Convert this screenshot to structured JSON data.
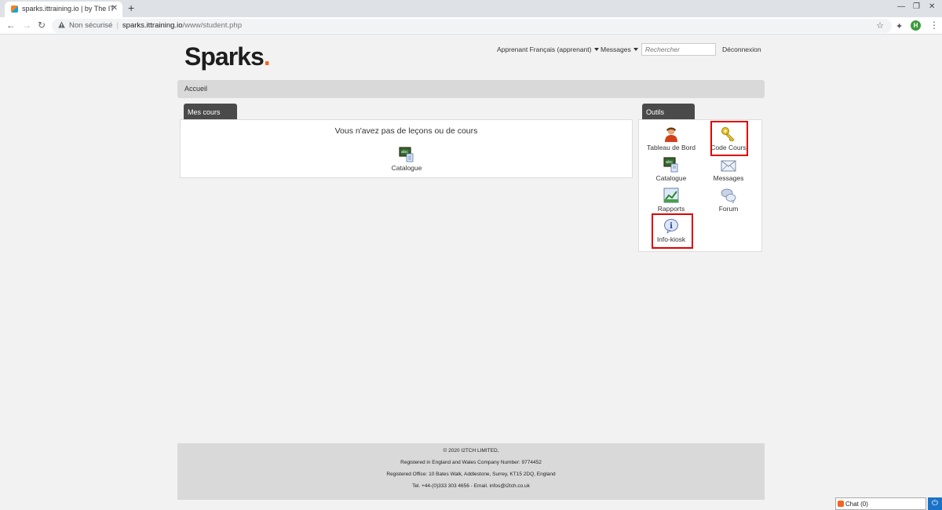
{
  "browser": {
    "tab_title": "sparks.ittraining.io | by The IT",
    "tab_close": "✕",
    "new_tab": "+",
    "address_insecure": "Non sécurisé",
    "address_domain": "sparks.ittraining.io",
    "address_path": "/www/student.php",
    "profile_initial": "H"
  },
  "header": {
    "logo_text": "Sparks",
    "logo_dot": ".",
    "user_menu": "Apprenant Français (apprenant)",
    "messages_menu": "Messages",
    "search_placeholder": "Rechercher",
    "logout": "Déconnexion"
  },
  "breadcrumb": {
    "label": "Accueil"
  },
  "courses": {
    "tab_label": "Mes cours",
    "empty_message": "Vous n'avez pas de leçons ou de cours",
    "catalogue_label": "Catalogue"
  },
  "tools": {
    "tab_label": "Outils",
    "items": [
      {
        "label": "Tableau de Bord",
        "icon": "user-icon",
        "highlighted": false
      },
      {
        "label": "Code Cours",
        "icon": "key-icon",
        "highlighted": true
      },
      {
        "label": "Catalogue",
        "icon": "catalogue-icon",
        "highlighted": false
      },
      {
        "label": "Messages",
        "icon": "envelope-icon",
        "highlighted": false
      },
      {
        "label": "Rapports",
        "icon": "report-chart-icon",
        "highlighted": false
      },
      {
        "label": "Forum",
        "icon": "forum-bubbles-icon",
        "highlighted": false
      },
      {
        "label": "Info-kiosk",
        "icon": "info-icon",
        "highlighted": true
      }
    ],
    "highlight_color": "#e00000"
  },
  "footer": {
    "line1": "© 2020 I2TCH LIMITED,",
    "line2": "Registered in England and Wales Company Number: 9774452",
    "line3": "Registered Office: 10 Bates Walk, Addlestone, Surrey, KT15 2DQ, England",
    "line4": "Tel. +44-(0)333 303 4656 - Email. infos@i2tch.co.uk"
  },
  "chat": {
    "label": "Chat (0)"
  },
  "colors": {
    "brand_accent": "#f26522",
    "panel_tab_bg": "#4a4a4a"
  }
}
